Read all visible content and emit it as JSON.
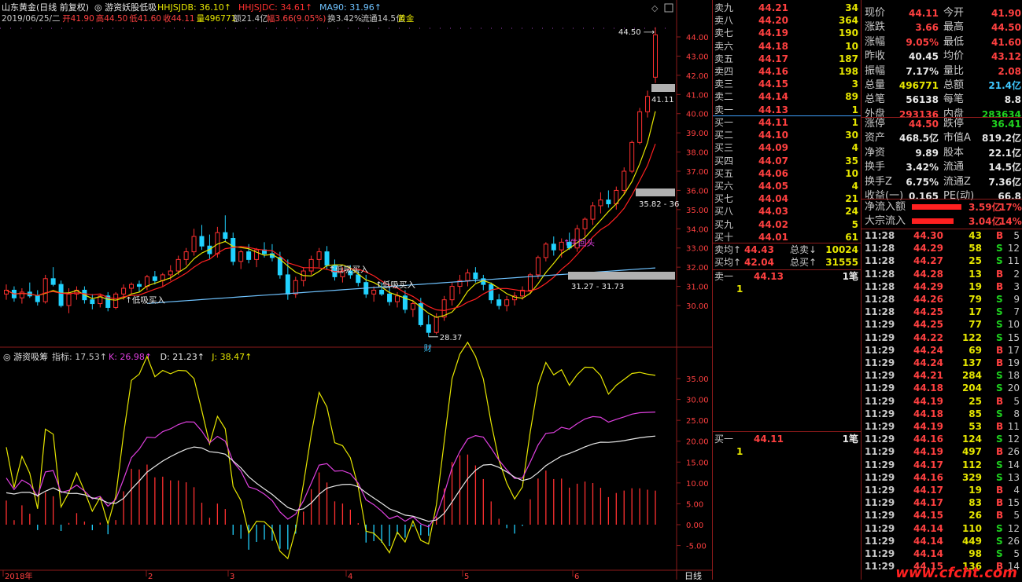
{
  "header": {
    "title": "山东黄金(日线 前复权)",
    "indicator_name": "游资妖股低吸",
    "ma_items": [
      {
        "label": "HHJSJDB: 36.10↑",
        "color": "#e6e600"
      },
      {
        "label": "HHJSJDC: 34.61↑",
        "color": "#ff3030"
      },
      {
        "label": "MA90: 31.96↑",
        "color": "#6fc3ff"
      }
    ],
    "info_line": [
      {
        "t": "2019/06/25/二",
        "c": "#c8c8c8"
      },
      {
        "t": "开41.90",
        "c": "#ff4040"
      },
      {
        "t": "高44.50",
        "c": "#ff4040"
      },
      {
        "t": "低41.60",
        "c": "#ff4040"
      },
      {
        "t": "收44.11",
        "c": "#ff4040"
      },
      {
        "t": "量496771",
        "c": "#e6e600"
      },
      {
        "t": "额21.4亿",
        "c": "#c8c8c8"
      },
      {
        "t": "幅3.66(9.05%)",
        "c": "#ff4040"
      },
      {
        "t": "换3.42%",
        "c": "#c8c8c8"
      },
      {
        "t": "流通14.5亿",
        "c": "#c8c8c8"
      },
      {
        "t": "黄金",
        "c": "#e6e600"
      }
    ]
  },
  "price_axis": [
    "44.00",
    "43.00",
    "42.00",
    "41.00",
    "40.00",
    "39.00",
    "38.00",
    "37.00",
    "36.00",
    "35.00",
    "34.00",
    "33.00",
    "32.00",
    "31.00",
    "30.00"
  ],
  "annotations": {
    "high_label": "44.50",
    "open_box_label": "41.11",
    "box1_label": "35.82 - 36",
    "box2_label": "31.27 - 31.73",
    "low_label": "28.37",
    "cai_label": "财",
    "buy_signals": [
      "低吸买入",
      "低吸买入",
      "低吸买入"
    ],
    "reversal_label": "牛回头"
  },
  "osc_header": {
    "name": "游资吸筹",
    "items": [
      {
        "label": "指标: 17.53↑",
        "color": "#c8c8c8"
      },
      {
        "label": "K: 26.98↑",
        "color": "#e040e0"
      },
      {
        "label": "D: 21.23↑",
        "color": "#e8e8e8"
      },
      {
        "label": "J: 38.47↑",
        "color": "#e6e600"
      }
    ]
  },
  "osc_axis": [
    "35.00",
    "30.00",
    "25.00",
    "20.00",
    "15.00",
    "10.00",
    "5.00",
    "0.00",
    "-5.00"
  ],
  "time_axis": [
    "2018年",
    "2",
    "3",
    "4",
    "5",
    "6"
  ],
  "period_label": "日线",
  "chart_data": {
    "type": "candlestick",
    "title": "山东黄金(日线 前复权)",
    "ylim": [
      28.3,
      44.6
    ],
    "candles_ohlc": [
      [
        30.6,
        31.1,
        30.3,
        30.8
      ],
      [
        30.8,
        31.0,
        30.2,
        30.4
      ],
      [
        30.4,
        30.9,
        30.1,
        30.7
      ],
      [
        30.7,
        31.2,
        30.4,
        30.5
      ],
      [
        30.5,
        30.8,
        30.0,
        30.2
      ],
      [
        30.2,
        31.6,
        30.1,
        31.4
      ],
      [
        31.4,
        32.0,
        31.0,
        31.1
      ],
      [
        31.1,
        31.3,
        29.9,
        30.0
      ],
      [
        30.0,
        30.9,
        29.6,
        30.6
      ],
      [
        30.6,
        31.0,
        30.3,
        30.8
      ],
      [
        30.8,
        31.0,
        30.1,
        30.3
      ],
      [
        30.3,
        30.6,
        29.8,
        30.1
      ],
      [
        30.1,
        30.6,
        29.9,
        30.5
      ],
      [
        30.5,
        30.7,
        29.7,
        29.9
      ],
      [
        29.9,
        30.7,
        29.8,
        30.6
      ],
      [
        30.6,
        31.1,
        30.3,
        30.9
      ],
      [
        30.9,
        31.2,
        30.6,
        31.1
      ],
      [
        31.1,
        31.3,
        30.7,
        31.0
      ],
      [
        31.0,
        31.6,
        30.8,
        31.5
      ],
      [
        31.5,
        31.8,
        31.1,
        31.3
      ],
      [
        31.3,
        31.7,
        31.0,
        31.6
      ],
      [
        31.6,
        32.1,
        31.3,
        31.8
      ],
      [
        31.8,
        32.6,
        31.6,
        32.4
      ],
      [
        32.4,
        33.0,
        32.1,
        32.8
      ],
      [
        32.8,
        34.0,
        32.6,
        33.6
      ],
      [
        33.6,
        34.2,
        32.9,
        33.1
      ],
      [
        33.1,
        33.7,
        32.4,
        32.7
      ],
      [
        32.7,
        34.1,
        32.5,
        33.8
      ],
      [
        33.8,
        34.7,
        33.3,
        33.5
      ],
      [
        33.5,
        33.8,
        32.1,
        32.3
      ],
      [
        32.3,
        32.9,
        31.9,
        32.8
      ],
      [
        32.8,
        33.2,
        32.2,
        32.4
      ],
      [
        32.4,
        33.0,
        32.0,
        32.9
      ],
      [
        32.9,
        33.3,
        32.5,
        32.7
      ],
      [
        32.7,
        33.2,
        32.3,
        32.5
      ],
      [
        32.5,
        32.8,
        31.4,
        31.6
      ],
      [
        31.6,
        32.4,
        30.3,
        30.6
      ],
      [
        30.6,
        31.5,
        30.4,
        31.3
      ],
      [
        31.3,
        32.0,
        31.0,
        31.8
      ],
      [
        31.8,
        32.6,
        31.6,
        32.4
      ],
      [
        32.4,
        33.0,
        32.0,
        32.8
      ],
      [
        32.8,
        33.1,
        31.9,
        32.1
      ],
      [
        32.1,
        32.4,
        31.3,
        31.5
      ],
      [
        31.5,
        32.0,
        31.2,
        31.8
      ],
      [
        31.8,
        32.1,
        31.4,
        31.6
      ],
      [
        31.6,
        31.8,
        31.0,
        31.2
      ],
      [
        31.2,
        31.6,
        30.4,
        30.6
      ],
      [
        30.6,
        31.0,
        30.2,
        30.8
      ],
      [
        30.8,
        31.2,
        30.5,
        30.6
      ],
      [
        30.6,
        30.9,
        30.0,
        30.2
      ],
      [
        30.2,
        30.7,
        29.9,
        30.5
      ],
      [
        30.5,
        30.8,
        29.6,
        29.8
      ],
      [
        29.8,
        30.3,
        29.4,
        30.1
      ],
      [
        30.1,
        30.4,
        28.9,
        29.0
      ],
      [
        29.0,
        29.5,
        28.37,
        28.6
      ],
      [
        28.6,
        29.6,
        28.5,
        29.4
      ],
      [
        29.4,
        30.5,
        29.2,
        30.3
      ],
      [
        30.3,
        31.2,
        30.0,
        31.0
      ],
      [
        31.0,
        31.6,
        30.6,
        31.3
      ],
      [
        31.3,
        31.9,
        31.0,
        31.7
      ],
      [
        31.7,
        32.0,
        31.2,
        31.4
      ],
      [
        31.4,
        31.6,
        30.8,
        31.1
      ],
      [
        31.1,
        31.2,
        30.1,
        30.3
      ],
      [
        30.3,
        30.6,
        29.8,
        30.0
      ],
      [
        30.0,
        30.5,
        29.7,
        30.3
      ],
      [
        30.3,
        30.7,
        30.0,
        30.5
      ],
      [
        30.5,
        31.0,
        30.3,
        30.8
      ],
      [
        30.8,
        31.7,
        30.6,
        31.6
      ],
      [
        31.6,
        32.6,
        31.4,
        32.5
      ],
      [
        32.5,
        33.3,
        32.3,
        33.2
      ],
      [
        33.2,
        33.6,
        32.6,
        32.9
      ],
      [
        32.9,
        33.5,
        32.5,
        33.3
      ],
      [
        33.3,
        33.8,
        32.9,
        33.0
      ],
      [
        33.0,
        34.2,
        32.8,
        34.0
      ],
      [
        34.0,
        34.6,
        33.6,
        34.5
      ],
      [
        34.5,
        35.4,
        34.2,
        35.2
      ],
      [
        35.2,
        35.9,
        34.8,
        35.5
      ],
      [
        35.5,
        36.0,
        35.1,
        35.3
      ],
      [
        35.3,
        36.2,
        35.0,
        36.0
      ],
      [
        36.0,
        37.2,
        35.8,
        37.0
      ],
      [
        37.0,
        38.6,
        36.9,
        38.5
      ],
      [
        38.5,
        40.3,
        38.4,
        40.1
      ],
      [
        40.1,
        41.2,
        39.8,
        40.9
      ],
      [
        41.9,
        44.5,
        41.6,
        44.11
      ]
    ],
    "ma_series": [
      {
        "name": "HHJSJDB",
        "last": 36.1
      },
      {
        "name": "HHJSJDC",
        "last": 34.61
      },
      {
        "name": "MA90",
        "last": 31.96
      }
    ],
    "oscillator": {
      "name": "游资吸筹",
      "ylim": [
        -8,
        38
      ],
      "last": {
        "指标": 17.53,
        "K": 26.98,
        "D": 21.23,
        "J": 38.47
      }
    }
  },
  "orderbook": {
    "asks": [
      {
        "label": "卖九",
        "price": "44.21",
        "vol": "34"
      },
      {
        "label": "卖八",
        "price": "44.20",
        "vol": "364"
      },
      {
        "label": "卖七",
        "price": "44.19",
        "vol": "190"
      },
      {
        "label": "卖六",
        "price": "44.18",
        "vol": "10"
      },
      {
        "label": "卖五",
        "price": "44.17",
        "vol": "187"
      },
      {
        "label": "卖四",
        "price": "44.16",
        "vol": "198"
      },
      {
        "label": "卖三",
        "price": "44.15",
        "vol": "3"
      },
      {
        "label": "卖二",
        "price": "44.14",
        "vol": "89"
      },
      {
        "label": "卖一",
        "price": "44.13",
        "vol": "1"
      }
    ],
    "bids": [
      {
        "label": "买一",
        "price": "44.11",
        "vol": "1"
      },
      {
        "label": "买二",
        "price": "44.10",
        "vol": "30"
      },
      {
        "label": "买三",
        "price": "44.09",
        "vol": "4"
      },
      {
        "label": "买四",
        "price": "44.07",
        "vol": "35"
      },
      {
        "label": "买五",
        "price": "44.06",
        "vol": "10"
      },
      {
        "label": "买六",
        "price": "44.05",
        "vol": "4"
      },
      {
        "label": "买七",
        "price": "44.04",
        "vol": "21"
      },
      {
        "label": "买八",
        "price": "44.03",
        "vol": "24"
      },
      {
        "label": "买九",
        "price": "44.02",
        "vol": "5"
      },
      {
        "label": "买十",
        "price": "44.01",
        "vol": "61"
      }
    ],
    "avg_sell_label": "卖均↑",
    "avg_sell": "44.43",
    "total_sell_label": "总卖↓",
    "total_sell": "10024",
    "avg_buy_label": "买均↑",
    "avg_buy": "42.04",
    "total_buy_label": "总买↑",
    "total_buy": "31555",
    "ask1_detail": {
      "label": "卖一",
      "price": "44.13",
      "count": "1笔",
      "queue": "1"
    },
    "bid1_detail": {
      "label": "买一",
      "price": "44.11",
      "count": "1笔",
      "queue": "1"
    }
  },
  "stats": [
    {
      "k1": "现价",
      "v1": "44.11",
      "c1": "#ff4040",
      "k2": "今开",
      "v2": "41.90",
      "c2": "#ff4040"
    },
    {
      "k1": "涨跌",
      "v1": "3.66",
      "c1": "#ff4040",
      "k2": "最高",
      "v2": "44.50",
      "c2": "#ff4040"
    },
    {
      "k1": "涨幅",
      "v1": "9.05%",
      "c1": "#ff4040",
      "k2": "最低",
      "v2": "41.60",
      "c2": "#ff4040"
    },
    {
      "k1": "昨收",
      "v1": "40.45",
      "c1": "#e8e8e8",
      "k2": "均价",
      "v2": "43.12",
      "c2": "#ff4040"
    },
    {
      "k1": "振幅",
      "v1": "7.17%",
      "c1": "#e8e8e8",
      "k2": "量比",
      "v2": "2.08",
      "c2": "#ff4040"
    },
    {
      "k1": "总量",
      "v1": "496771",
      "c1": "#e6e600",
      "k2": "总额",
      "v2": "21.4亿",
      "c2": "#3fc8ff"
    },
    {
      "k1": "总笔",
      "v1": "56138",
      "c1": "#e8e8e8",
      "k2": "每笔",
      "v2": "8.8",
      "c2": "#e8e8e8"
    },
    {
      "k1": "外盘",
      "v1": "293136",
      "c1": "#ff4040",
      "k2": "内盘",
      "v2": "283634",
      "c2": "#1fd11f"
    },
    {
      "k1": "涨停",
      "v1": "44.50",
      "c1": "#ff4040",
      "k2": "跌停",
      "v2": "36.41",
      "c2": "#1fd11f"
    },
    {
      "k1": "资产",
      "v1": "468.5亿",
      "c1": "#e8e8e8",
      "k2": "市值A",
      "v2": "819.2亿",
      "c2": "#e8e8e8"
    },
    {
      "k1": "净资",
      "v1": "9.89",
      "c1": "#e8e8e8",
      "k2": "股本",
      "v2": "22.1亿",
      "c2": "#e8e8e8"
    },
    {
      "k1": "换手",
      "v1": "3.42%",
      "c1": "#e8e8e8",
      "k2": "流通",
      "v2": "14.5亿",
      "c2": "#e8e8e8"
    },
    {
      "k1": "换手Z",
      "v1": "6.75%",
      "c1": "#e8e8e8",
      "k2": "流通Z",
      "v2": "7.36亿",
      "c2": "#e8e8e8"
    },
    {
      "k1": "收益(一)",
      "v1": "0.165",
      "c1": "#e8e8e8",
      "k2": "PE(动)",
      "v2": "66.8",
      "c2": "#e8e8e8"
    }
  ],
  "flows": [
    {
      "label": "净流入额",
      "value": "3.59亿",
      "pct": "17%",
      "fill": 0.9
    },
    {
      "label": "大宗流入",
      "value": "3.04亿",
      "pct": "14%",
      "fill": 0.75
    }
  ],
  "ticks": [
    {
      "time": "11:28",
      "price": "44.30",
      "pc": "#ff4040",
      "vol": "43",
      "side": "B",
      "cnt": "5"
    },
    {
      "time": "11:28",
      "price": "44.29",
      "pc": "#ff4040",
      "vol": "58",
      "side": "S",
      "cnt": "12"
    },
    {
      "time": "11:28",
      "price": "44.27",
      "pc": "#ff4040",
      "vol": "25",
      "side": "S",
      "cnt": "11"
    },
    {
      "time": "11:28",
      "price": "44.28",
      "pc": "#ff4040",
      "vol": "13",
      "side": "B",
      "cnt": "2"
    },
    {
      "time": "11:28",
      "price": "44.29",
      "pc": "#ff4040",
      "vol": "19",
      "side": "B",
      "cnt": "3"
    },
    {
      "time": "11:28",
      "price": "44.26",
      "pc": "#ff4040",
      "vol": "79",
      "side": "S",
      "cnt": "9"
    },
    {
      "time": "11:28",
      "price": "44.25",
      "pc": "#ff4040",
      "vol": "17",
      "side": "S",
      "cnt": "7"
    },
    {
      "time": "11:29",
      "price": "44.25",
      "pc": "#ff4040",
      "vol": "77",
      "side": "S",
      "cnt": "10"
    },
    {
      "time": "11:29",
      "price": "44.22",
      "pc": "#ff4040",
      "vol": "122",
      "side": "S",
      "cnt": "15"
    },
    {
      "time": "11:29",
      "price": "44.24",
      "pc": "#ff4040",
      "vol": "69",
      "side": "B",
      "cnt": "17"
    },
    {
      "time": "11:29",
      "price": "44.24",
      "pc": "#ff4040",
      "vol": "137",
      "side": "B",
      "cnt": "19"
    },
    {
      "time": "11:29",
      "price": "44.21",
      "pc": "#ff4040",
      "vol": "284",
      "side": "S",
      "cnt": "18"
    },
    {
      "time": "11:29",
      "price": "44.18",
      "pc": "#ff4040",
      "vol": "204",
      "side": "S",
      "cnt": "20"
    },
    {
      "time": "11:29",
      "price": "44.19",
      "pc": "#ff4040",
      "vol": "25",
      "side": "B",
      "cnt": "5"
    },
    {
      "time": "11:29",
      "price": "44.18",
      "pc": "#ff4040",
      "vol": "85",
      "side": "S",
      "cnt": "8"
    },
    {
      "time": "11:29",
      "price": "44.19",
      "pc": "#ff4040",
      "vol": "53",
      "side": "B",
      "cnt": "11"
    },
    {
      "time": "11:29",
      "price": "44.16",
      "pc": "#ff4040",
      "vol": "124",
      "side": "S",
      "cnt": "12"
    },
    {
      "time": "11:29",
      "price": "44.19",
      "pc": "#ff4040",
      "vol": "497",
      "side": "B",
      "cnt": "26"
    },
    {
      "time": "11:29",
      "price": "44.17",
      "pc": "#ff4040",
      "vol": "112",
      "side": "S",
      "cnt": "14"
    },
    {
      "time": "11:29",
      "price": "44.16",
      "pc": "#ff4040",
      "vol": "329",
      "side": "S",
      "cnt": "13"
    },
    {
      "time": "11:29",
      "price": "44.17",
      "pc": "#ff4040",
      "vol": "19",
      "side": "B",
      "cnt": "4"
    },
    {
      "time": "11:29",
      "price": "44.17",
      "pc": "#ff4040",
      "vol": "83",
      "side": "B",
      "cnt": "15"
    },
    {
      "time": "11:29",
      "price": "44.15",
      "pc": "#ff4040",
      "vol": "26",
      "side": "B",
      "cnt": "5"
    },
    {
      "time": "11:29",
      "price": "44.14",
      "pc": "#ff4040",
      "vol": "110",
      "side": "S",
      "cnt": "12"
    },
    {
      "time": "11:29",
      "price": "44.14",
      "pc": "#ff4040",
      "vol": "449",
      "side": "S",
      "cnt": "26"
    },
    {
      "time": "11:29",
      "price": "44.14",
      "pc": "#ff4040",
      "vol": "98",
      "side": "S",
      "cnt": "5"
    },
    {
      "time": "11:29",
      "price": "44.15",
      "pc": "#ff4040",
      "vol": "136",
      "side": "B",
      "cnt": "14"
    }
  ],
  "watermark": "www.cfcht.com"
}
